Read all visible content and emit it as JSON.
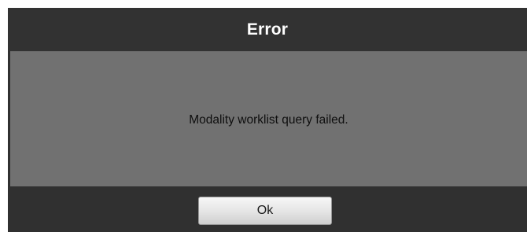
{
  "dialog": {
    "title": "Error",
    "message": "Modality worklist query failed.",
    "ok_label": "Ok"
  },
  "colors": {
    "titlebar": "#323232",
    "body": "#717171",
    "footer": "#303030",
    "title_text": "#ffffff",
    "message_text": "#0e0e0e"
  }
}
